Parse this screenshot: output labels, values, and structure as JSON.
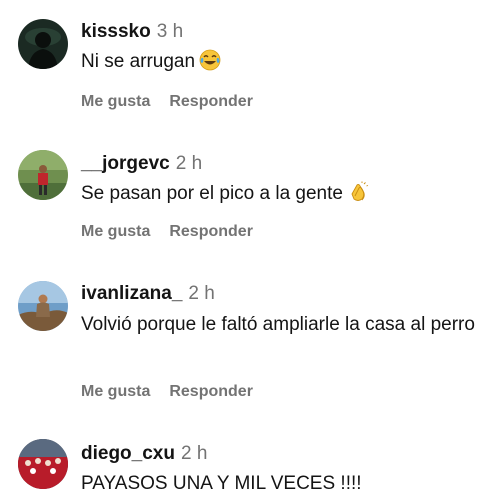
{
  "comments": [
    {
      "username": "kisssko",
      "time": "3 h",
      "text": "Ni se arrugan",
      "emoji": "tears-of-joy-emoji",
      "like_label": "Me gusta",
      "reply_label": "Responder"
    },
    {
      "username": "__jorgevc",
      "time": "2 h",
      "text": "Se pasan por el pico a la gente",
      "emoji": "clapping-hands-emoji",
      "like_label": "Me gusta",
      "reply_label": "Responder"
    },
    {
      "username": "ivanlizana_",
      "time": "2 h",
      "text": "Volvió porque le faltó ampliarle la casa al perro",
      "like_label": "Me gusta",
      "reply_label": "Responder"
    },
    {
      "username": "diego_cxu",
      "time": "2 h",
      "text": "PAYASOS UNA Y MIL VECES !!!!"
    }
  ],
  "colors": {
    "text": "#141414",
    "muted": "#737373",
    "background": "#ffffff"
  }
}
